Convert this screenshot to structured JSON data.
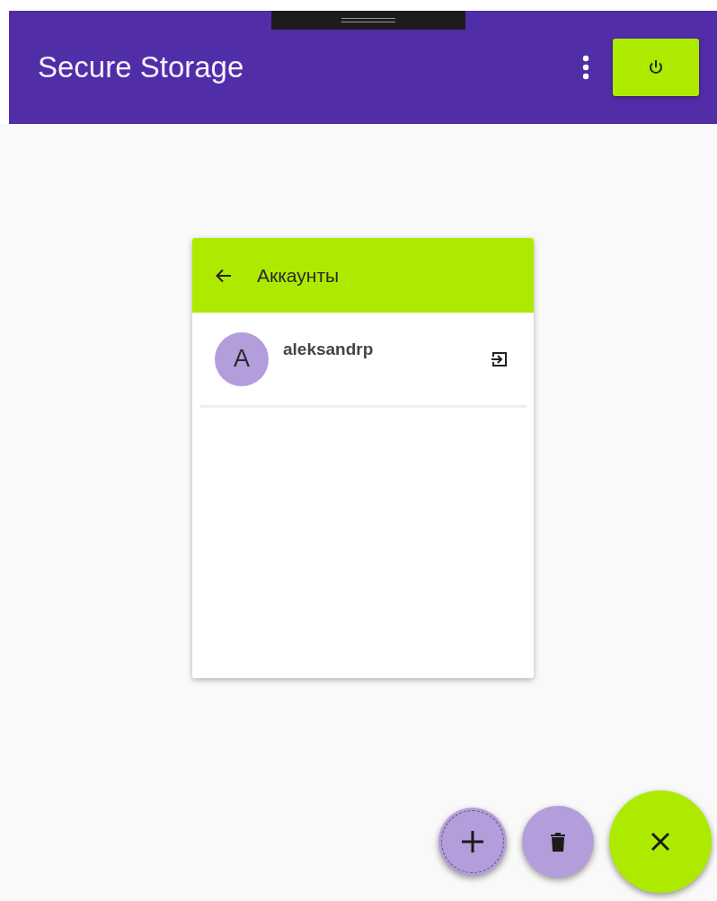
{
  "app_bar": {
    "title": "Secure Storage"
  },
  "panel": {
    "title": "Аккаунты",
    "accounts": [
      {
        "initial": "A",
        "name": "aleksandrp"
      }
    ]
  },
  "fabs": [
    {
      "kind": "add",
      "focused": true
    },
    {
      "kind": "delete",
      "focused": false
    },
    {
      "kind": "close",
      "focused": false
    }
  ]
}
